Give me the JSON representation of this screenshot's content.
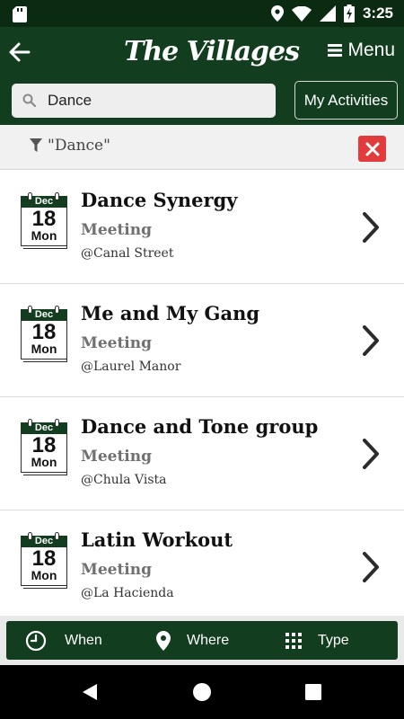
{
  "status_bar": {
    "time": "3:25",
    "icons": [
      "sd-card-icon",
      "location-icon",
      "wifi-icon",
      "signal-icon",
      "battery-icon"
    ]
  },
  "app_bar": {
    "logo_text": "The Villages",
    "menu_label": "Menu"
  },
  "search": {
    "value": "Dance",
    "my_activities_label": "My Activities"
  },
  "filter": {
    "text": "\"Dance\""
  },
  "events": [
    {
      "month": "Dec",
      "day": "18",
      "weekday": "Mon",
      "title": "Dance Synergy",
      "type": "Meeting",
      "location": "@Canal Street"
    },
    {
      "month": "Dec",
      "day": "18",
      "weekday": "Mon",
      "title": "Me and My Gang",
      "type": "Meeting",
      "location": "@Laurel Manor"
    },
    {
      "month": "Dec",
      "day": "18",
      "weekday": "Mon",
      "title": "Dance and Tone group",
      "type": "Meeting",
      "location": "@Chula Vista"
    },
    {
      "month": "Dec",
      "day": "18",
      "weekday": "Mon",
      "title": "Latin Workout",
      "type": "Meeting",
      "location": "@La Hacienda"
    }
  ],
  "tabs": {
    "when": "When",
    "where": "Where",
    "type": "Type"
  },
  "colors": {
    "brand_green": "#123d1f",
    "status_bar": "#0b2a12",
    "clear_red": "#e23b3b"
  }
}
